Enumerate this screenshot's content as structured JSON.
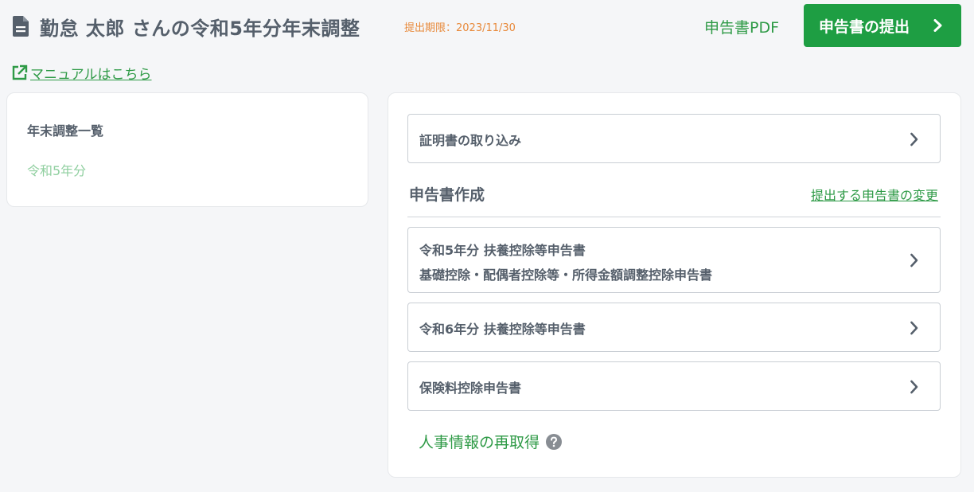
{
  "header": {
    "title": "勤怠 太郎 さんの令和5年分年末調整",
    "deadline": "提出期限：2023/11/30",
    "pdf_label": "申告書PDF",
    "submit_label": "申告書の提出"
  },
  "manual_link": "マニュアルはこちら",
  "sidebar": {
    "title": "年末調整一覧",
    "items": [
      "令和5年分"
    ]
  },
  "main": {
    "import_label": "証明書の取り込み",
    "section_title": "申告書作成",
    "change_link": "提出する申告書の変更",
    "forms": [
      {
        "line1": "令和5年分 扶養控除等申告書",
        "line2": "基礎控除・配偶者控除等・所得金額調整控除申告書"
      },
      {
        "line1": "令和6年分 扶養控除等申告書"
      },
      {
        "line1": "保険料控除申告書"
      }
    ],
    "refetch_label": "人事情報の再取得"
  },
  "colors": {
    "accent": "#1e9e43",
    "link": "#2e9a46",
    "deadline": "#e8893a",
    "muted_green": "#8fcf9f",
    "text": "#555f6b",
    "background": "#f5f6f8"
  },
  "icons": {
    "title": "document-icon",
    "submit": "chevron-right-icon",
    "manual": "external-link-icon",
    "rows": "chevron-right-icon",
    "help": "question-circle-icon"
  }
}
